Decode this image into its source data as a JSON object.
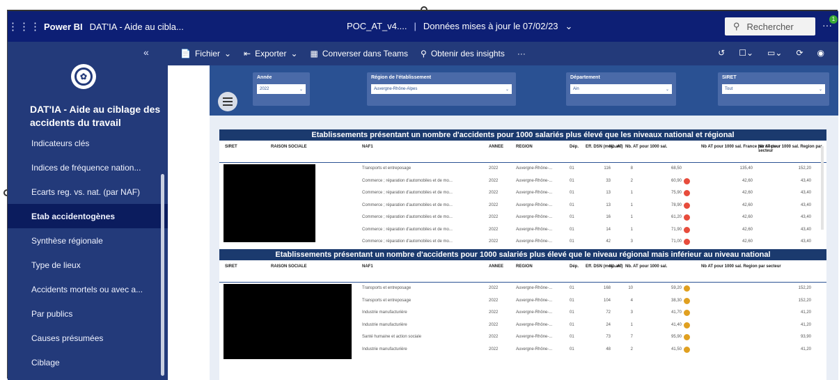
{
  "appbar": {
    "brand": "Power BI",
    "report_name": "DAT'IA - Aide au cibla...",
    "file_name": "POC_AT_v4....",
    "separator": "|",
    "updated": "Données mises à jour le 07/02/23",
    "chevron": "⌄",
    "search_placeholder": "Rechercher",
    "more": "···",
    "notif_count": "1"
  },
  "sidebar": {
    "collapse": "«",
    "title": "DAT'IA - Aide au ciblage des accidents du travail",
    "items": [
      {
        "label": "Indicateurs clés"
      },
      {
        "label": "Indices de fréquence nation..."
      },
      {
        "label": "Ecarts reg. vs. nat. (par NAF)"
      },
      {
        "label": "Etab accidentogènes"
      },
      {
        "label": "Synthèse régionale"
      },
      {
        "label": "Type de lieux"
      },
      {
        "label": "Accidents mortels ou avec a..."
      },
      {
        "label": "Par publics"
      },
      {
        "label": "Causes présumées"
      },
      {
        "label": "Ciblage"
      }
    ],
    "active_index": 3
  },
  "toolbar": {
    "file": "Fichier",
    "export": "Exporter",
    "teams": "Converser dans Teams",
    "insights": "Obtenir des insights",
    "more": "···"
  },
  "filters": [
    {
      "label": "Année",
      "value": "2022"
    },
    {
      "label": "Région de l'établissement",
      "value": "Auvergne-Rhône-Alpes"
    },
    {
      "label": "Département",
      "value": "Ain"
    },
    {
      "label": "SIRET",
      "value": "Tout"
    }
  ],
  "table1": {
    "title": "Etablissements présentant un nombre d'accidents pour 1000 salariés plus élevé que les niveaux national et régional",
    "headers": [
      "SIRET",
      "RAISON SOCIALE",
      "NAF1",
      "ANNEE",
      "REGION",
      "Dép.",
      "Eff. DSN (moy. an.)",
      "Nb. AT",
      "Nb. AT pour 1000 sal.",
      "Nb AT pour 1000 sal. France par secteur",
      "Nb AT pour 1000 sal. Region par secteur"
    ],
    "rows": [
      {
        "naf": "Transports et entreposage",
        "annee": "2022",
        "region": "Auvergne-Rhône-...",
        "dep": "01",
        "eff": "116",
        "at": "8",
        "ratio": "68,50",
        "dot": "",
        "fr": "135,40",
        "reg": "152,20"
      },
      {
        "naf": "Commerce ; réparation d'automobiles et de mo...",
        "annee": "2022",
        "region": "Auvergne-Rhône-...",
        "dep": "01",
        "eff": "33",
        "at": "2",
        "ratio": "60,90",
        "dot": "#e74c3c",
        "fr": "42,60",
        "reg": "43,40"
      },
      {
        "naf": "Commerce ; réparation d'automobiles et de mo...",
        "annee": "2022",
        "region": "Auvergne-Rhône-...",
        "dep": "01",
        "eff": "13",
        "at": "1",
        "ratio": "75,90",
        "dot": "#e74c3c",
        "fr": "42,60",
        "reg": "43,40"
      },
      {
        "naf": "Commerce ; réparation d'automobiles et de mo...",
        "annee": "2022",
        "region": "Auvergne-Rhône-...",
        "dep": "01",
        "eff": "13",
        "at": "1",
        "ratio": "78,90",
        "dot": "#e74c3c",
        "fr": "42,60",
        "reg": "43,40"
      },
      {
        "naf": "Commerce ; réparation d'automobiles et de mo...",
        "annee": "2022",
        "region": "Auvergne-Rhône-...",
        "dep": "01",
        "eff": "16",
        "at": "1",
        "ratio": "61,20",
        "dot": "#e74c3c",
        "fr": "42,60",
        "reg": "43,40"
      },
      {
        "naf": "Commerce ; réparation d'automobiles et de mo...",
        "annee": "2022",
        "region": "Auvergne-Rhône-...",
        "dep": "01",
        "eff": "14",
        "at": "1",
        "ratio": "71,90",
        "dot": "#e74c3c",
        "fr": "42,60",
        "reg": "43,40"
      },
      {
        "naf": "Commerce ; réparation d'automobiles et de mo...",
        "annee": "2022",
        "region": "Auvergne-Rhône-...",
        "dep": "01",
        "eff": "42",
        "at": "3",
        "ratio": "71,00",
        "dot": "#e74c3c",
        "fr": "42,60",
        "reg": "43,40"
      }
    ]
  },
  "table2": {
    "title": "Etablissements présentant un nombre d'accidents pour 1000 salariés plus élevé que le niveau régional mais inférieur au niveau national",
    "headers": [
      "SIRET",
      "RAISON SOCIALE",
      "NAF1",
      "ANNEE",
      "REGION",
      "Dép.",
      "Eff. DSN (moy. an.)",
      "Nb. AT",
      "Nb. AT pour 1000 sal.",
      "Nb AT pour 1000 sal. Region par secteur"
    ],
    "rows": [
      {
        "naf": "Transports et entreposage",
        "annee": "2022",
        "region": "Auvergne-Rhône-...",
        "dep": "01",
        "eff": "168",
        "at": "10",
        "ratio": "59,20",
        "dot": "#e0a020",
        "reg": "152,20"
      },
      {
        "naf": "Transports et entreposage",
        "annee": "2022",
        "region": "Auvergne-Rhône-...",
        "dep": "01",
        "eff": "104",
        "at": "4",
        "ratio": "38,30",
        "dot": "#e0a020",
        "reg": "152,20"
      },
      {
        "naf": "Industrie manufacturière",
        "annee": "2022",
        "region": "Auvergne-Rhône-...",
        "dep": "01",
        "eff": "72",
        "at": "3",
        "ratio": "41,70",
        "dot": "#e0a020",
        "reg": "41,20"
      },
      {
        "naf": "Industrie manufacturière",
        "annee": "2022",
        "region": "Auvergne-Rhône-...",
        "dep": "01",
        "eff": "24",
        "at": "1",
        "ratio": "41,40",
        "dot": "#e0a020",
        "reg": "41,20"
      },
      {
        "naf": "Santé humaine et action sociale",
        "annee": "2022",
        "region": "Auvergne-Rhône-...",
        "dep": "01",
        "eff": "73",
        "at": "7",
        "ratio": "95,90",
        "dot": "#e0a020",
        "reg": "93,90"
      },
      {
        "naf": "Industrie manufacturière",
        "annee": "2022",
        "region": "Auvergne-Rhône-...",
        "dep": "01",
        "eff": "48",
        "at": "2",
        "ratio": "41,50",
        "dot": "#e0a020",
        "reg": "41,20"
      }
    ]
  }
}
